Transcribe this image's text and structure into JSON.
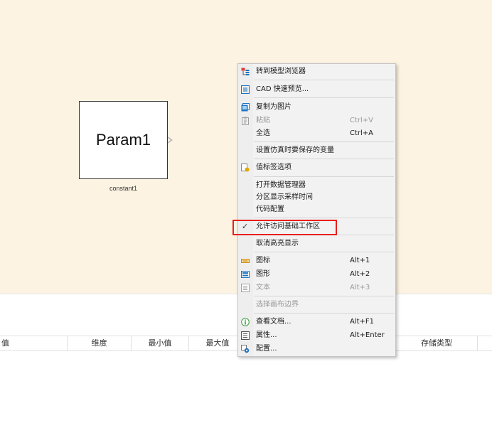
{
  "canvas": {
    "block_text": "Param1",
    "block_name": "constant1"
  },
  "table": {
    "headers": [
      "值",
      "维度",
      "最小值",
      "最大值",
      "存储类型"
    ]
  },
  "menu": {
    "items": [
      {
        "label": "转到模型浏览器",
        "shortcut": "",
        "icon": "model-browser-icon",
        "disabled": false
      },
      {
        "label": "CAD 快速预览...",
        "shortcut": "",
        "icon": "cad-preview-icon",
        "disabled": false
      },
      {
        "label": "复制为图片",
        "shortcut": "",
        "icon": "copy-image-icon",
        "disabled": false
      },
      {
        "label": "粘贴",
        "shortcut": "Ctrl+V",
        "icon": "paste-icon",
        "disabled": true
      },
      {
        "label": "全选",
        "shortcut": "Ctrl+A",
        "icon": "",
        "disabled": false
      },
      {
        "label": "设置仿真时要保存的变量",
        "shortcut": "",
        "icon": "",
        "disabled": false
      },
      {
        "label": "值标签选项",
        "shortcut": "",
        "icon": "value-label-icon",
        "disabled": false
      },
      {
        "label": "打开数据管理器",
        "shortcut": "",
        "icon": "",
        "disabled": false
      },
      {
        "label": "分区显示采样时间",
        "shortcut": "",
        "icon": "",
        "disabled": false
      },
      {
        "label": "代码配置",
        "shortcut": "",
        "icon": "",
        "disabled": false
      },
      {
        "label": "允许访问基础工作区",
        "shortcut": "",
        "icon": "check-icon",
        "disabled": false
      },
      {
        "label": "取消高亮显示",
        "shortcut": "",
        "icon": "",
        "disabled": false
      },
      {
        "label": "图标",
        "shortcut": "Alt+1",
        "icon": "icon-view-icon",
        "disabled": false
      },
      {
        "label": "图形",
        "shortcut": "Alt+2",
        "icon": "graphic-view-icon",
        "disabled": false
      },
      {
        "label": "文本",
        "shortcut": "Alt+3",
        "icon": "text-view-icon",
        "disabled": true
      },
      {
        "label": "选择画布边界",
        "shortcut": "",
        "icon": "",
        "disabled": true
      },
      {
        "label": "查看文档...",
        "shortcut": "Alt+F1",
        "icon": "info-icon",
        "disabled": false
      },
      {
        "label": "属性...",
        "shortcut": "Alt+Enter",
        "icon": "properties-icon",
        "disabled": false
      },
      {
        "label": "配置...",
        "shortcut": "",
        "icon": "settings-icon",
        "disabled": false
      }
    ]
  },
  "colors": {
    "canvas_bg": "#fdf3e2",
    "highlight": "#e8201c",
    "accent": "#1e73be"
  }
}
